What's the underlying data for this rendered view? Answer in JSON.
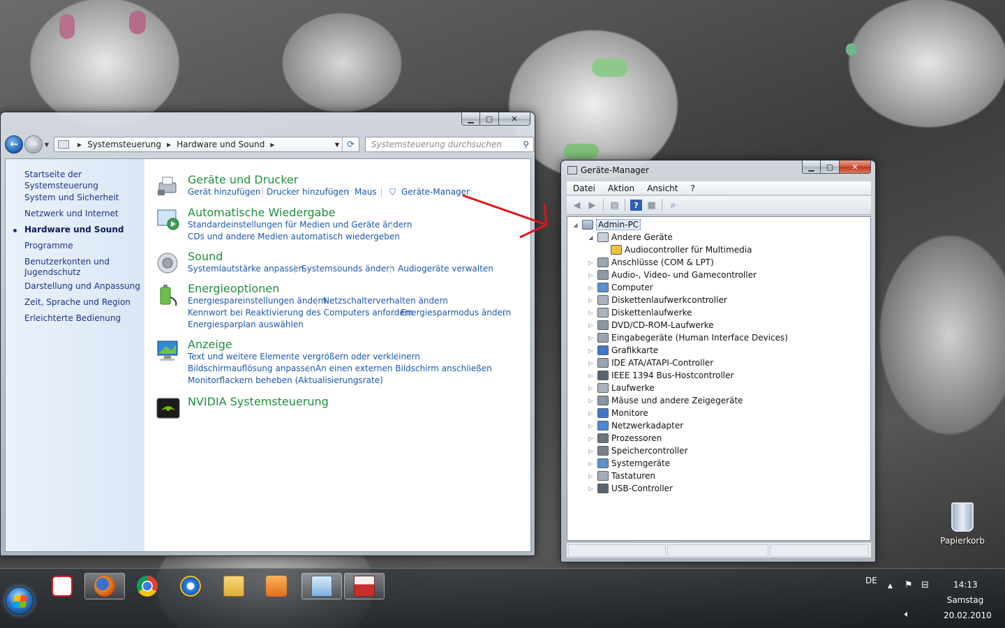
{
  "control_panel": {
    "breadcrumb": [
      "Systemsteuerung",
      "Hardware und Sound"
    ],
    "search_placeholder": "Systemsteuerung durchsuchen",
    "sidebar": {
      "home": "Startseite der Systemsteuerung",
      "items": [
        "System und Sicherheit",
        "Netzwerk und Internet",
        "Hardware und Sound",
        "Programme",
        "Benutzerkonten und",
        "Jugendschutz",
        "Darstellung und Anpassung",
        "Zeit, Sprache und Region",
        "Erleichterte Bedienung"
      ]
    },
    "categories": [
      {
        "title": "Geräte und Drucker",
        "links": [
          "Gerät hinzufügen",
          "Drucker hinzufügen",
          "Maus",
          "Geräte-Manager"
        ]
      },
      {
        "title": "Automatische Wiedergabe",
        "links": [
          "Standardeinstellungen für Medien und Geräte ändern",
          "CDs und andere Medien automatisch wiedergeben"
        ]
      },
      {
        "title": "Sound",
        "links": [
          "Systemlautstärke anpassen",
          "Systemsounds ändern",
          "Audiogeräte verwalten"
        ]
      },
      {
        "title": "Energieoptionen",
        "links": [
          "Energiespareinstellungen ändern",
          "Netzschalterverhalten ändern",
          "Kennwort bei Reaktivierung des Computers anfordern",
          "Energiesparmodus ändern",
          "Energiesparplan auswählen"
        ]
      },
      {
        "title": "Anzeige",
        "links": [
          "Text und weitere Elemente vergrößern oder verkleinern",
          "Bildschirmauflösung anpassen",
          "An einen externen Bildschirm anschließen",
          "Monitorflackern beheben (Aktualisierungsrate)"
        ]
      },
      {
        "title": "NVIDIA Systemsteuerung",
        "links": []
      }
    ]
  },
  "device_manager": {
    "title": "Geräte-Manager",
    "menu": [
      "Datei",
      "Aktion",
      "Ansicht",
      "?"
    ],
    "root": "Admin-PC",
    "nodes": [
      "Andere Geräte",
      "Audiocontroller für Multimedia",
      "Anschlüsse (COM & LPT)",
      "Audio-, Video- und Gamecontroller",
      "Computer",
      "Diskettenlaufwerkcontroller",
      "Diskettenlaufwerke",
      "DVD/CD-ROM-Laufwerke",
      "Eingabegeräte (Human Interface Devices)",
      "Grafikkarte",
      "IDE ATA/ATAPI-Controller",
      "IEEE 1394 Bus-Hostcontroller",
      "Laufwerke",
      "Mäuse und andere Zeigegeräte",
      "Monitore",
      "Netzwerkadapter",
      "Prozessoren",
      "Speichercontroller",
      "Systemgeräte",
      "Tastaturen",
      "USB-Controller"
    ]
  },
  "desktop": {
    "recycle_bin": "Papierkorb"
  },
  "taskbar": {
    "language": "DE",
    "time": "14:13",
    "day": "Samstag",
    "date": "20.02.2010"
  },
  "colors": {
    "category_title": "#1f8f3a",
    "link": "#1a57b0",
    "sidebar_bg": "#dbe7f6",
    "annotation_arrow": "#e2141c"
  }
}
